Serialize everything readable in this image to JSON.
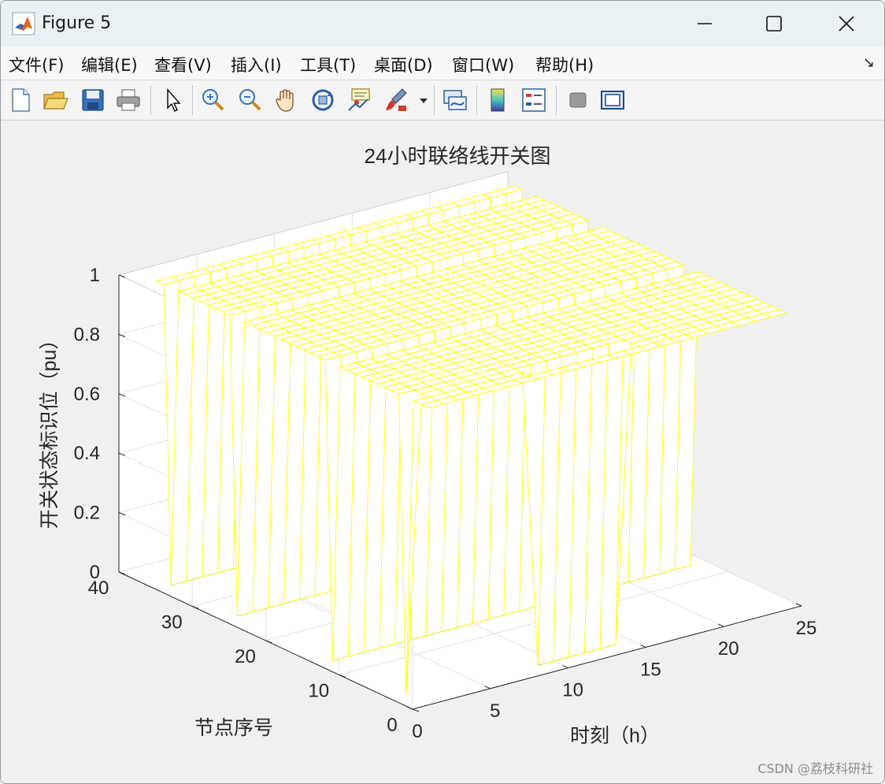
{
  "window": {
    "title": "Figure 5",
    "controls": {
      "minimize": "minimize-icon",
      "maximize": "maximize-icon",
      "close": "close-icon"
    }
  },
  "menu": {
    "items": [
      "文件(F)",
      "编辑(E)",
      "查看(V)",
      "插入(I)",
      "工具(T)",
      "桌面(D)",
      "窗口(W)",
      "帮助(H)"
    ],
    "overflow_arrow": "↘"
  },
  "toolbar": {
    "buttons": [
      "new-figure-icon",
      "open-file-icon",
      "save-icon",
      "print-icon",
      "pointer-icon",
      "zoom-in-icon",
      "zoom-out-icon",
      "pan-hand-icon",
      "rotate-3d-icon",
      "data-cursor-icon",
      "brush-icon",
      "brush-dropdown-icon",
      "link-plot-icon",
      "colorbar-icon",
      "legend-icon",
      "hide-tools-icon",
      "show-tools-icon"
    ]
  },
  "watermark": "CSDN @荔枝科研社",
  "chart_data": {
    "type": "surface",
    "title": "24小时联络线开关图",
    "xlabel": "时刻（h）",
    "ylabel": "节点序号",
    "zlabel": "开关状态标识位（pu）",
    "xlim": [
      0,
      25
    ],
    "ylim": [
      0,
      40
    ],
    "zlim": [
      0,
      1
    ],
    "xticks": [
      0,
      5,
      10,
      15,
      20,
      25
    ],
    "yticks": [
      0,
      10,
      20,
      30,
      40
    ],
    "zticks": [
      0,
      0.2,
      0.4,
      0.6,
      0.8,
      1
    ],
    "x": [
      1,
      24
    ],
    "y": [
      0,
      37
    ],
    "z_values": [
      0,
      1
    ],
    "open_rows": [
      {
        "node": 2,
        "x_start": 9,
        "x_end": 14
      },
      {
        "node": 3,
        "x_start": 1,
        "x_end": 1
      },
      {
        "node": 13,
        "x_start": 1,
        "x_end": 24
      },
      {
        "node": 26,
        "x_start": 1,
        "x_end": 24
      },
      {
        "node": 35,
        "x_start": 1,
        "x_end": 24
      }
    ],
    "edge_color": "#ffff00",
    "face_color": "#ffffff",
    "grid": true
  }
}
